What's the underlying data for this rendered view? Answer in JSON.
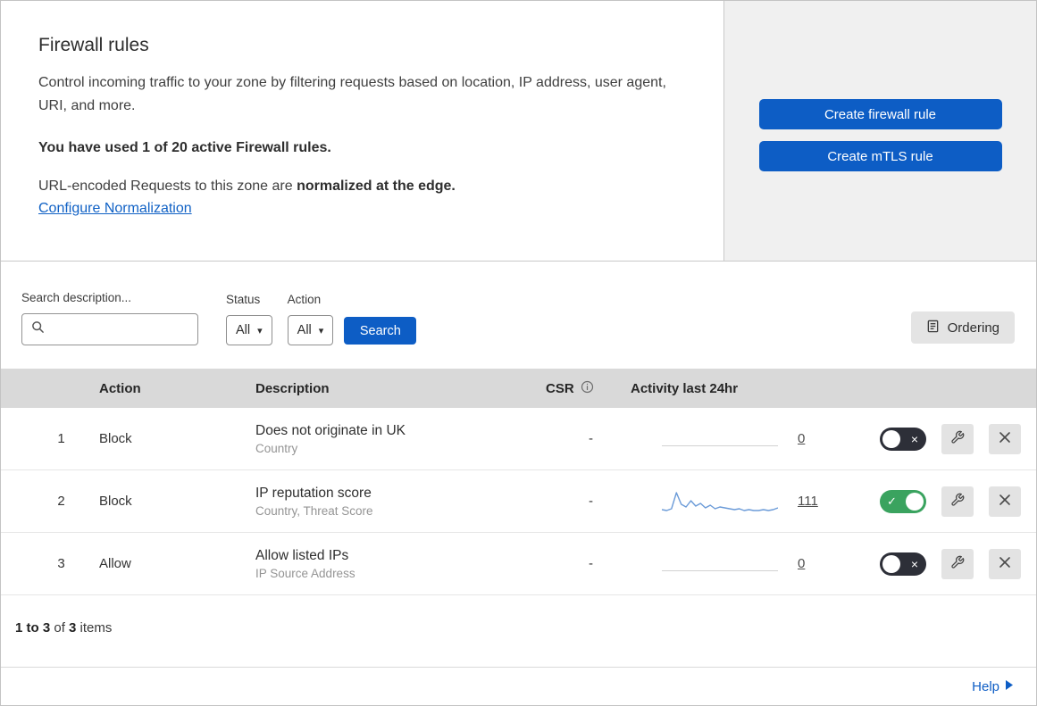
{
  "header": {
    "title": "Firewall rules",
    "description": "Control incoming traffic to your zone by filtering requests based on location, IP address, user agent, URI, and more.",
    "usage_notice": "You have used 1 of 20 active Firewall rules.",
    "normalization_text": "URL-encoded Requests to this zone are ",
    "normalization_bold": "normalized at the edge.",
    "normalization_link": "Configure Normalization"
  },
  "actions_panel": {
    "create_firewall_rule": "Create firewall rule",
    "create_mtls_rule": "Create mTLS rule"
  },
  "filters": {
    "search_label": "Search description...",
    "status_label": "Status",
    "status_value": "All",
    "action_label": "Action",
    "action_value": "All",
    "search_button": "Search",
    "ordering_button": "Ordering"
  },
  "table": {
    "headers": {
      "action": "Action",
      "description": "Description",
      "csr": "CSR",
      "activity": "Activity last 24hr"
    },
    "rows": [
      {
        "priority": "1",
        "action": "Block",
        "description": "Does not originate in UK",
        "fields": "Country",
        "csr": "-",
        "activity_count": "0",
        "enabled": false
      },
      {
        "priority": "2",
        "action": "Block",
        "description": "IP reputation score",
        "fields": "Country, Threat Score",
        "csr": "-",
        "activity_count": "111",
        "enabled": true,
        "sparkline": [
          3,
          2,
          4,
          22,
          9,
          6,
          13,
          7,
          10,
          5,
          8,
          4,
          6,
          5,
          4,
          3,
          4,
          2,
          3,
          2,
          2,
          3,
          2,
          3,
          5
        ]
      },
      {
        "priority": "3",
        "action": "Allow",
        "description": "Allow listed IPs",
        "fields": "IP Source Address",
        "csr": "-",
        "activity_count": "0",
        "enabled": false
      }
    ],
    "footer": {
      "range": "1 to 3",
      "of": " of ",
      "total": "3",
      "items": " items"
    }
  },
  "help_link": "Help",
  "colors": {
    "primary_blue": "#0d5dc5",
    "link_blue": "#1061c5",
    "toggle_on_green": "#3aa35f",
    "toggle_off_dark": "#2d2f38",
    "sparkline_blue": "#6b9bd8",
    "table_header_bg": "#d9d9d9",
    "panel_bg": "#f0f0f0"
  }
}
